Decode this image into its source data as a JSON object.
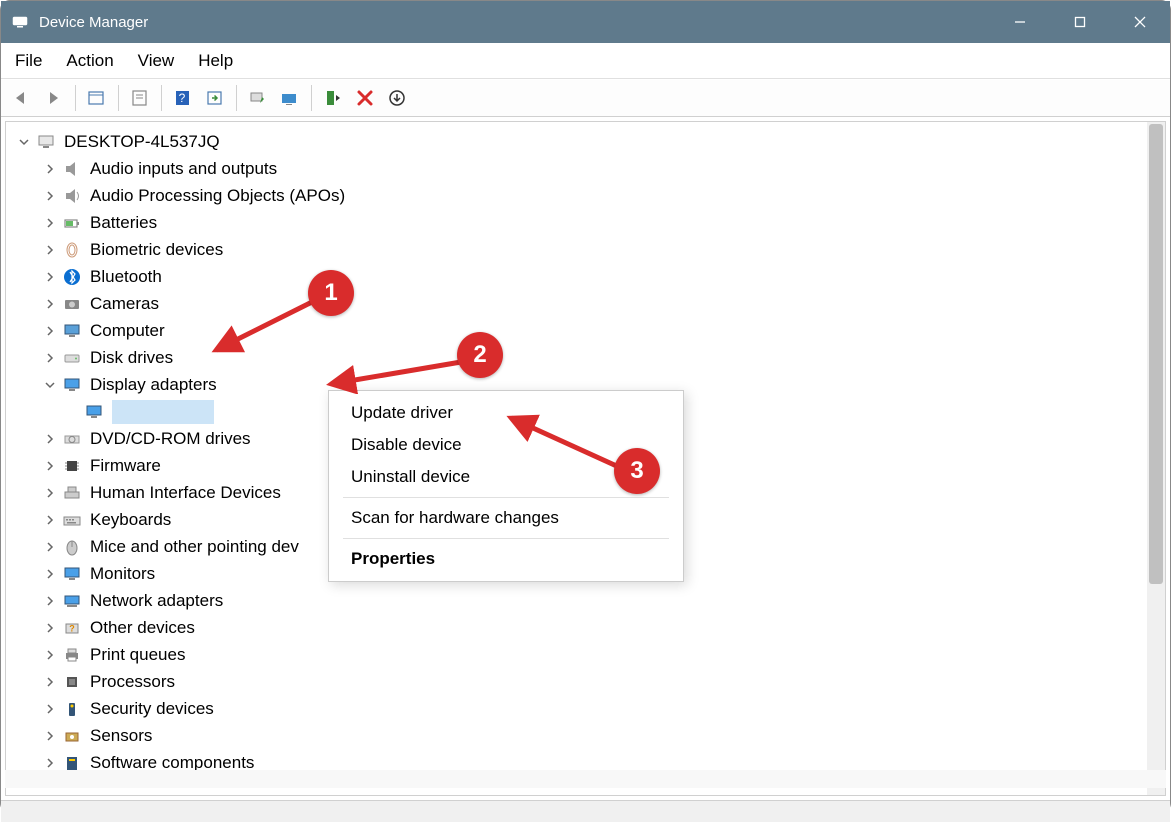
{
  "window": {
    "title": "Device Manager"
  },
  "menu": {
    "file": "File",
    "action": "Action",
    "view": "View",
    "help": "Help"
  },
  "tree": {
    "root": "DESKTOP-4L537JQ",
    "items": [
      "Audio inputs and outputs",
      "Audio Processing Objects (APOs)",
      "Batteries",
      "Biometric devices",
      "Bluetooth",
      "Cameras",
      "Computer",
      "Disk drives",
      "Display adapters",
      "DVD/CD-ROM drives",
      "Firmware",
      "Human Interface Devices",
      "Keyboards",
      "Mice and other pointing dev",
      "Monitors",
      "Network adapters",
      "Other devices",
      "Print queues",
      "Processors",
      "Security devices",
      "Sensors",
      "Software components"
    ],
    "selected_child": ""
  },
  "context_menu": {
    "update": "Update driver",
    "disable": "Disable device",
    "uninstall": "Uninstall device",
    "scan": "Scan for hardware changes",
    "properties": "Properties"
  },
  "annotations": {
    "a1": "1",
    "a2": "2",
    "a3": "3"
  }
}
